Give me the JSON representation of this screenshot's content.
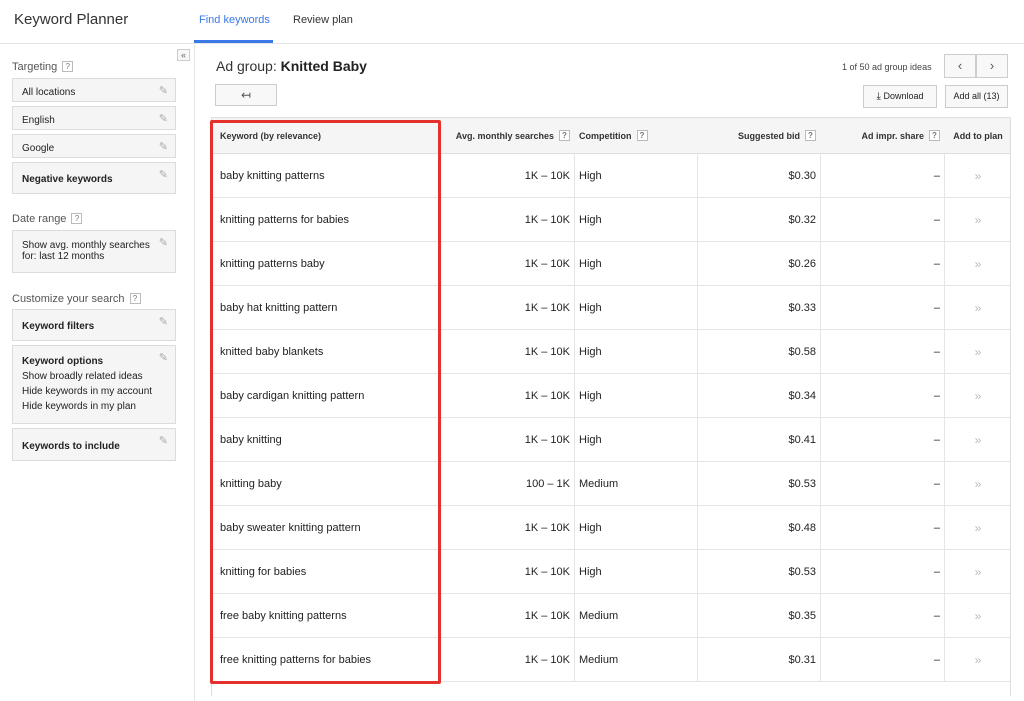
{
  "header": {
    "app_title": "Keyword Planner",
    "tabs": [
      {
        "label": "Find keywords",
        "active": true
      },
      {
        "label": "Review plan",
        "active": false
      }
    ]
  },
  "sidebar": {
    "collapse_glyph": "«",
    "targeting_label": "Targeting",
    "targeting_items": [
      "All locations",
      "English",
      "Google"
    ],
    "negative_keywords_label": "Negative keywords",
    "date_range_label": "Date range",
    "date_range_value_line1": "Show avg. monthly searches",
    "date_range_value_line2": "for: last 12 months",
    "customize_label": "Customize your search",
    "keyword_filters_label": "Keyword filters",
    "keyword_options": {
      "title": "Keyword options",
      "lines": [
        "Show broadly related ideas",
        "Hide keywords in my account",
        "Hide keywords in my plan"
      ]
    },
    "keywords_to_include_label": "Keywords to include"
  },
  "main": {
    "adgroup_prefix": "Ad group:",
    "adgroup_name": "Knitted Baby",
    "pager_text": "1 of 50 ad group ideas",
    "download_label": "Download",
    "add_all_label": "Add all (13)"
  },
  "table": {
    "columns": [
      "Keyword (by relevance)",
      "Avg. monthly searches",
      "Competition",
      "Suggested bid",
      "Ad impr. share",
      "Add to plan"
    ],
    "rows": [
      {
        "keyword": "baby knitting patterns",
        "avg": "1K – 10K",
        "competition": "High",
        "bid": "$0.30",
        "impr": "–"
      },
      {
        "keyword": "knitting patterns for babies",
        "avg": "1K – 10K",
        "competition": "High",
        "bid": "$0.32",
        "impr": "–"
      },
      {
        "keyword": "knitting patterns baby",
        "avg": "1K – 10K",
        "competition": "High",
        "bid": "$0.26",
        "impr": "–"
      },
      {
        "keyword": "baby hat knitting pattern",
        "avg": "1K – 10K",
        "competition": "High",
        "bid": "$0.33",
        "impr": "–"
      },
      {
        "keyword": "knitted baby blankets",
        "avg": "1K – 10K",
        "competition": "High",
        "bid": "$0.58",
        "impr": "–"
      },
      {
        "keyword": "baby cardigan knitting pattern",
        "avg": "1K – 10K",
        "competition": "High",
        "bid": "$0.34",
        "impr": "–"
      },
      {
        "keyword": "baby knitting",
        "avg": "1K – 10K",
        "competition": "High",
        "bid": "$0.41",
        "impr": "–"
      },
      {
        "keyword": "knitting baby",
        "avg": "100 – 1K",
        "competition": "Medium",
        "bid": "$0.53",
        "impr": "–"
      },
      {
        "keyword": "baby sweater knitting pattern",
        "avg": "1K – 10K",
        "competition": "High",
        "bid": "$0.48",
        "impr": "–"
      },
      {
        "keyword": "knitting for babies",
        "avg": "1K – 10K",
        "competition": "High",
        "bid": "$0.53",
        "impr": "–"
      },
      {
        "keyword": "free baby knitting patterns",
        "avg": "1K – 10K",
        "competition": "Medium",
        "bid": "$0.35",
        "impr": "–"
      },
      {
        "keyword": "free knitting patterns for babies",
        "avg": "1K – 10K",
        "competition": "Medium",
        "bid": "$0.31",
        "impr": "–"
      }
    ],
    "add_glyph": "»"
  },
  "colors": {
    "accent": "#3b78e7",
    "highlight": "#e4312b"
  }
}
